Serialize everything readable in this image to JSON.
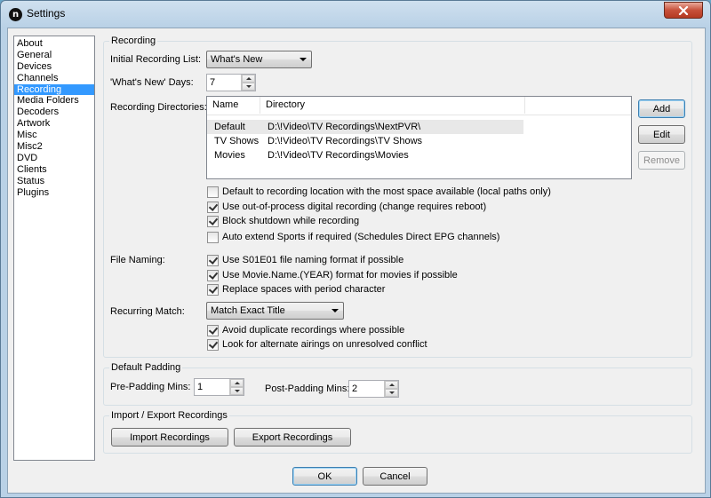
{
  "window": {
    "title": "Settings"
  },
  "nav": {
    "items": [
      "About",
      "General",
      "Devices",
      "Channels",
      "Recording",
      "Media Folders",
      "Decoders",
      "Artwork",
      "Misc",
      "Misc2",
      "DVD",
      "Clients",
      "Status",
      "Plugins"
    ],
    "selected_index": 4
  },
  "recording": {
    "group_title": "Recording",
    "initial_list_label": "Initial Recording List:",
    "initial_list_value": "What's New",
    "whats_new_days_label": "'What's New' Days:",
    "whats_new_days_value": "7",
    "directories_label": "Recording Directories:",
    "directories_columns": [
      "Name",
      "Directory"
    ],
    "directories": [
      {
        "name": "Default",
        "directory": "D:\\!Video\\TV Recordings\\NextPVR\\"
      },
      {
        "name": "TV Shows",
        "directory": "D:\\!Video\\TV Recordings\\TV Shows"
      },
      {
        "name": "Movies",
        "directory": "D:\\!Video\\TV Recordings\\Movies"
      }
    ],
    "add_label": "Add",
    "edit_label": "Edit",
    "remove_label": "Remove",
    "options": [
      {
        "label": "Default to recording location with the most space available (local paths only)",
        "checked": false
      },
      {
        "label": "Use out-of-process digital recording (change requires reboot)",
        "checked": true
      },
      {
        "label": "Block shutdown while recording",
        "checked": true
      },
      {
        "label": "Auto extend Sports if required (Schedules Direct EPG channels)",
        "checked": false
      }
    ],
    "file_naming_label": "File Naming:",
    "file_naming_options": [
      {
        "label": "Use S01E01 file naming format if possible",
        "checked": true
      },
      {
        "label": "Use Movie.Name.(YEAR) format for movies if possible",
        "checked": true
      },
      {
        "label": "Replace spaces with period character",
        "checked": true
      }
    ],
    "recurring_match_label": "Recurring Match:",
    "recurring_match_value": "Match Exact Title",
    "recurring_options": [
      {
        "label": "Avoid duplicate recordings where possible",
        "checked": true
      },
      {
        "label": "Look for alternate airings on unresolved conflict",
        "checked": true
      }
    ]
  },
  "padding": {
    "group_title": "Default Padding",
    "pre_label": "Pre-Padding Mins:",
    "pre_value": "1",
    "post_label": "Post-Padding Mins:",
    "post_value": "2"
  },
  "import_export": {
    "group_title": "Import / Export Recordings",
    "import_label": "Import Recordings",
    "export_label": "Export Recordings"
  },
  "footer": {
    "ok_label": "OK",
    "cancel_label": "Cancel"
  },
  "colors": {
    "selection": "#3399ff",
    "close_button": "#c7503a"
  }
}
